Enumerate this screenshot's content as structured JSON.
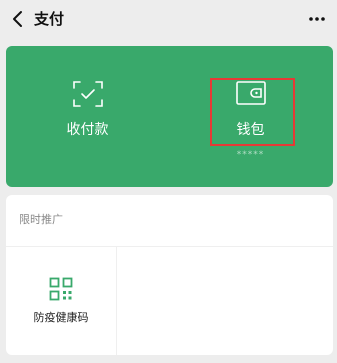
{
  "nav": {
    "title": "支付",
    "back_icon": "back-arrow-icon",
    "more_icon": "more-dots-icon"
  },
  "hero": {
    "background_color": "#39a96b",
    "items": [
      {
        "label": "收付款",
        "icon": "scan-check-icon"
      },
      {
        "label": "钱包",
        "icon": "wallet-icon",
        "balance": "*****"
      }
    ]
  },
  "highlight_color": "#e53935",
  "promo": {
    "header": "限时推广",
    "items": [
      {
        "label": "防疫健康码",
        "icon": "qr-code-icon",
        "icon_color": "#39a96b"
      }
    ]
  }
}
